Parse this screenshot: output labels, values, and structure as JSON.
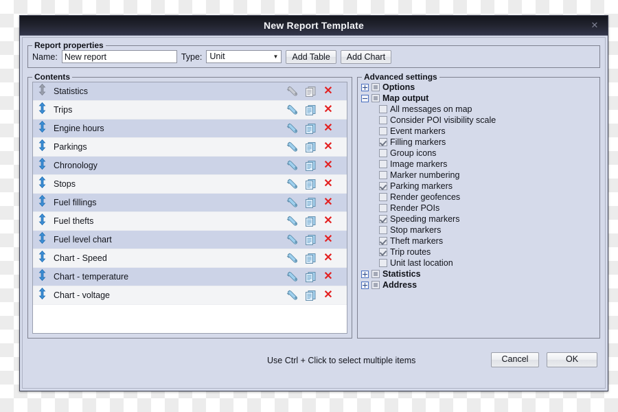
{
  "window": {
    "title": "New Report Template",
    "close_icon": "close-icon"
  },
  "report_properties": {
    "legend": "Report properties",
    "name_label": "Name:",
    "name_value": "New report",
    "name_placeholder": "",
    "type_label": "Type:",
    "type_value": "Unit",
    "type_options": [
      "Unit"
    ],
    "add_table_label": "Add Table",
    "add_chart_label": "Add Chart"
  },
  "contents": {
    "legend": "Contents",
    "rows": [
      {
        "label": "Statistics",
        "selected": true,
        "drag_icon": "reorder-arrows-icon",
        "wrench_icon": "wrench-icon",
        "copy_icon": "duplicate-icon",
        "delete_icon": "delete-x-icon"
      },
      {
        "label": "Trips",
        "selected": false,
        "drag_icon": "reorder-arrows-icon",
        "wrench_icon": "wrench-icon",
        "copy_icon": "duplicate-icon",
        "delete_icon": "delete-x-icon"
      },
      {
        "label": "Engine hours",
        "selected": true,
        "drag_icon": "reorder-arrows-icon",
        "wrench_icon": "wrench-icon",
        "copy_icon": "duplicate-icon",
        "delete_icon": "delete-x-icon"
      },
      {
        "label": "Parkings",
        "selected": false,
        "drag_icon": "reorder-arrows-icon",
        "wrench_icon": "wrench-icon",
        "copy_icon": "duplicate-icon",
        "delete_icon": "delete-x-icon"
      },
      {
        "label": "Chronology",
        "selected": true,
        "drag_icon": "reorder-arrows-icon",
        "wrench_icon": "wrench-icon",
        "copy_icon": "duplicate-icon",
        "delete_icon": "delete-x-icon"
      },
      {
        "label": "Stops",
        "selected": false,
        "drag_icon": "reorder-arrows-icon",
        "wrench_icon": "wrench-icon",
        "copy_icon": "duplicate-icon",
        "delete_icon": "delete-x-icon"
      },
      {
        "label": "Fuel fillings",
        "selected": true,
        "drag_icon": "reorder-arrows-icon",
        "wrench_icon": "wrench-icon",
        "copy_icon": "duplicate-icon",
        "delete_icon": "delete-x-icon"
      },
      {
        "label": "Fuel thefts",
        "selected": false,
        "drag_icon": "reorder-arrows-icon",
        "wrench_icon": "wrench-icon",
        "copy_icon": "duplicate-icon",
        "delete_icon": "delete-x-icon"
      },
      {
        "label": "Fuel level chart",
        "selected": true,
        "drag_icon": "reorder-arrows-icon",
        "wrench_icon": "wrench-icon",
        "copy_icon": "duplicate-icon",
        "delete_icon": "delete-x-icon"
      },
      {
        "label": "Chart - Speed",
        "selected": false,
        "drag_icon": "reorder-arrows-icon",
        "wrench_icon": "wrench-icon",
        "copy_icon": "duplicate-icon",
        "delete_icon": "delete-x-icon"
      },
      {
        "label": "Chart - temperature",
        "selected": true,
        "drag_icon": "reorder-arrows-icon",
        "wrench_icon": "wrench-icon",
        "copy_icon": "duplicate-icon",
        "delete_icon": "delete-x-icon"
      },
      {
        "label": "Chart - voltage",
        "selected": false,
        "drag_icon": "reorder-arrows-icon",
        "wrench_icon": "wrench-icon",
        "copy_icon": "duplicate-icon",
        "delete_icon": "delete-x-icon"
      }
    ]
  },
  "advanced_settings": {
    "legend": "Advanced settings",
    "nodes": [
      {
        "kind": "group",
        "label": "Options",
        "expanded": false,
        "state": "partial"
      },
      {
        "kind": "group",
        "label": "Map output",
        "expanded": true,
        "state": "partial"
      },
      {
        "kind": "leaf",
        "label": "All messages on map",
        "checked": false
      },
      {
        "kind": "leaf",
        "label": "Consider POI visibility scale",
        "checked": false
      },
      {
        "kind": "leaf",
        "label": "Event markers",
        "checked": false
      },
      {
        "kind": "leaf",
        "label": "Filling markers",
        "checked": true
      },
      {
        "kind": "leaf",
        "label": "Group icons",
        "checked": false
      },
      {
        "kind": "leaf",
        "label": "Image markers",
        "checked": false
      },
      {
        "kind": "leaf",
        "label": "Marker numbering",
        "checked": false
      },
      {
        "kind": "leaf",
        "label": "Parking markers",
        "checked": true
      },
      {
        "kind": "leaf",
        "label": "Render geofences",
        "checked": false
      },
      {
        "kind": "leaf",
        "label": "Render POIs",
        "checked": false
      },
      {
        "kind": "leaf",
        "label": "Speeding markers",
        "checked": true
      },
      {
        "kind": "leaf",
        "label": "Stop markers",
        "checked": false
      },
      {
        "kind": "leaf",
        "label": "Theft markers",
        "checked": true
      },
      {
        "kind": "leaf",
        "label": "Trip routes",
        "checked": true
      },
      {
        "kind": "leaf",
        "label": "Unit last location",
        "checked": false
      },
      {
        "kind": "group",
        "label": "Statistics",
        "expanded": false,
        "state": "partial"
      },
      {
        "kind": "group",
        "label": "Address",
        "expanded": false,
        "state": "partial"
      }
    ]
  },
  "footer": {
    "hint": "Use Ctrl + Click to select multiple items",
    "cancel_label": "Cancel",
    "ok_label": "OK"
  },
  "colors": {
    "titlebar_dark": "#14151c",
    "dialog_bg": "#d5daea",
    "row_selected": "#ccd3e7",
    "row_plain": "#f3f4f6",
    "accent_blue": "#3d8fd6",
    "delete_red": "#e32121",
    "expander_blue": "#4a6fbf"
  }
}
